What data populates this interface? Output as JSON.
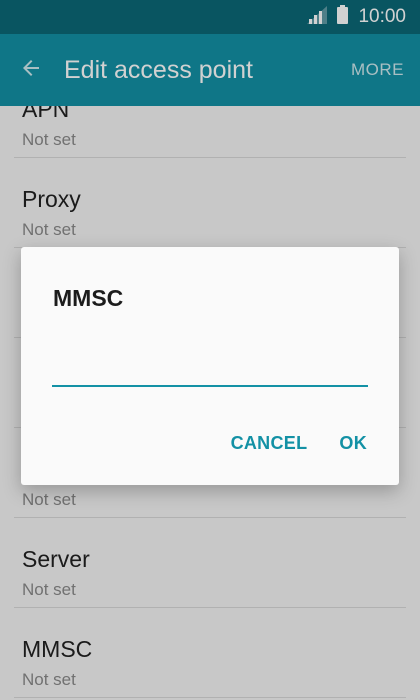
{
  "status_bar": {
    "time": "10:00",
    "icons": [
      "signal-icon",
      "battery-icon"
    ]
  },
  "app_bar": {
    "title": "Edit access point",
    "more_label": "MORE",
    "back_icon": "back-arrow-icon"
  },
  "list": {
    "items": [
      {
        "title": "APN",
        "subtitle": "Not set"
      },
      {
        "title": "Proxy",
        "subtitle": "Not set"
      },
      {
        "title": "",
        "subtitle": ""
      },
      {
        "title": "",
        "subtitle": ""
      },
      {
        "title": "",
        "subtitle": "Not set"
      },
      {
        "title": "Server",
        "subtitle": "Not set"
      },
      {
        "title": "MMSC",
        "subtitle": "Not set"
      }
    ]
  },
  "dialog": {
    "title": "MMSC",
    "input_value": "",
    "cancel_label": "CANCEL",
    "ok_label": "OK"
  },
  "colors": {
    "status_bar": "#0b6877",
    "app_bar": "#1391a5",
    "accent": "#1391a5"
  }
}
